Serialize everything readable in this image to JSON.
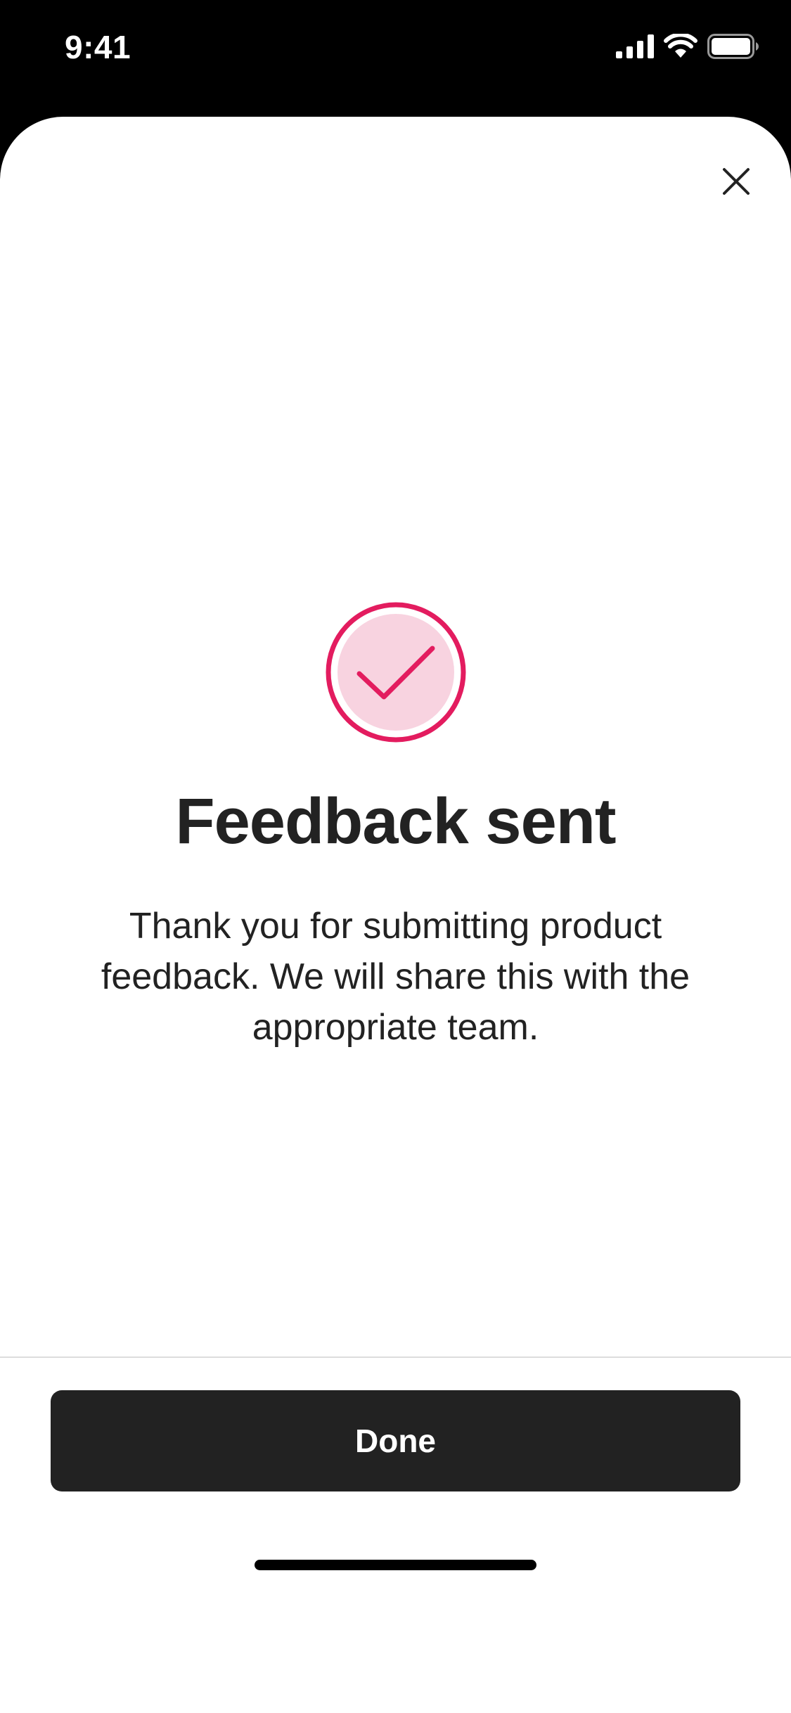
{
  "status_bar": {
    "time": "9:41",
    "icons": [
      "cellular-signal-icon",
      "wifi-icon",
      "battery-icon"
    ]
  },
  "sheet": {
    "close_icon": "close-icon",
    "badge_icon": "check-circle-icon",
    "title": "Feedback sent",
    "message": "Thank you for submitting product feedback. We will share this with the appropriate team.",
    "done_label": "Done"
  },
  "colors": {
    "accent": "#E31C5F",
    "accent_light": "#F8D3E0",
    "button_bg": "#222222",
    "text": "#222222"
  }
}
